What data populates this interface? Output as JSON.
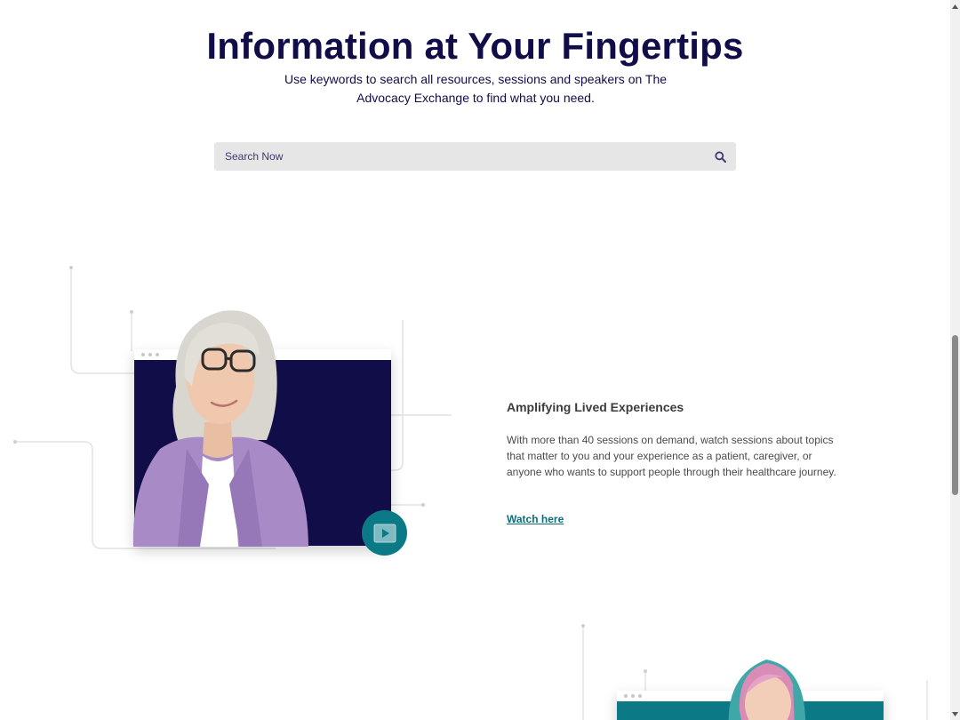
{
  "hero": {
    "title": "Information at Your Fingertips",
    "subtitle": "Use keywords to search all resources, sessions and speakers on The Advocacy Exchange to find what you need."
  },
  "search": {
    "placeholder": "Search Now",
    "value": "",
    "icon": "search-icon"
  },
  "feature": {
    "title": "Amplifying Lived Experiences",
    "description": "With more than 40 sessions on demand, watch sessions about topics that matter to you and your experience as a patient, caregiver, or anyone who wants to support people through their healthcare journey.",
    "link_label": "Watch here",
    "play_icon": "play-icon"
  },
  "colors": {
    "navy": "#110d48",
    "teal": "#0b7a86",
    "search_bg": "#e6e6e6",
    "link": "#0b6f7b"
  }
}
